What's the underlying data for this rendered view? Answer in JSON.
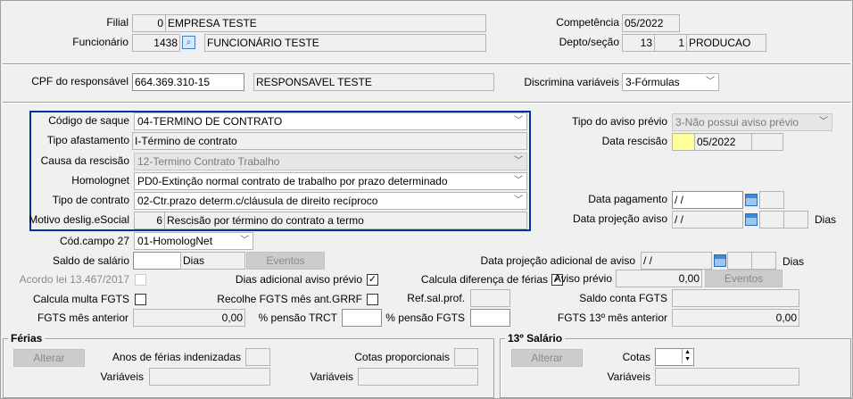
{
  "header": {
    "filial_label": "Filial",
    "filial_code": "0",
    "filial_name": "EMPRESA TESTE",
    "funcionario_label": "Funcionário",
    "funcionario_code": "1438",
    "funcionario_name": "FUNCIONÁRIO TESTE",
    "competencia_label": "Competência",
    "competencia": "05/2022",
    "depto_label": "Depto/seção",
    "depto": "13",
    "secao": "1",
    "depto_name": "PRODUCAO"
  },
  "responsavel": {
    "cpf_label": "CPF do responsável",
    "cpf": "664.369.310-15",
    "name": "RESPONSAVEL TESTE",
    "discrimina_label": "Discrimina variáveis",
    "discrimina": "3-Fórmulas"
  },
  "rescisao": {
    "codigo_saque_label": "Código de saque",
    "codigo_saque": "04-TERMINO DE CONTRATO",
    "tipo_afastamento_label": "Tipo afastamento",
    "tipo_afastamento": "I-Término de contrato",
    "causa_label": "Causa da rescisão",
    "causa": "12-Termino Contrato Trabalho",
    "homolognet_label": "Homolognet",
    "homolognet": "PD0-Extinção normal contrato de trabalho por prazo determinado",
    "tipo_contrato_label": "Tipo de contrato",
    "tipo_contrato": "02-Ctr.prazo determ.c/cláusula de direito recíproco",
    "motivo_label": "Motivo deslig.eSocial",
    "motivo_code": "6",
    "motivo": "Rescisão por término do contrato a termo"
  },
  "aviso": {
    "tipo_label": "Tipo do aviso prévio",
    "tipo": "3-Não possui aviso prévio",
    "data_rescisao_label": "Data rescisão",
    "data_rescisao": "05/2022",
    "data_pagamento_label": "Data pagamento",
    "data_pagamento": " / /",
    "data_projecao_label": "Data projeção aviso",
    "data_projecao": " / /",
    "dias_label": "Dias"
  },
  "outros": {
    "cod_campo27_label": "Cód.campo 27",
    "cod_campo27": "01-HomologNet",
    "saldo_label": "Saldo de salário",
    "saldo_dias": "Dias",
    "eventos": "Eventos",
    "proj_adicional_label": "Data projeção adicional de aviso",
    "proj_adicional": " / /",
    "dias_label": "Dias",
    "acordo_label": "Acordo lei 13.467/2017",
    "dias_adicional_label": "Dias adicional aviso prévio",
    "calc_dif_ferias_label": "Calcula diferença de férias",
    "aviso_previo_label": "Aviso prévio",
    "aviso_previo": "0,00",
    "calc_multa_label": "Calcula multa FGTS",
    "recolhe_label": "Recolhe FGTS mês ant.GRRF",
    "ref_sal_label": "Ref.sal.prof.",
    "saldo_fgts_label": "Saldo conta FGTS",
    "fgts_mes_ant_label": "FGTS mês anterior",
    "fgts_mes_ant": "0,00",
    "pensao_trct_label": "% pensão TRCT",
    "pensao_fgts_label": "% pensão FGTS",
    "fgts13_label": "FGTS 13º mês anterior",
    "fgts13": "0,00",
    "check": "✓"
  },
  "ferias": {
    "title": "Férias",
    "alterar": "Alterar",
    "anos_label": "Anos de férias indenizadas",
    "cotas_label": "Cotas proporcionais",
    "variaveis_label": "Variáveis"
  },
  "decimo": {
    "title": "13º Salário",
    "alterar": "Alterar",
    "cotas_label": "Cotas",
    "variaveis_label": "Variáveis"
  }
}
